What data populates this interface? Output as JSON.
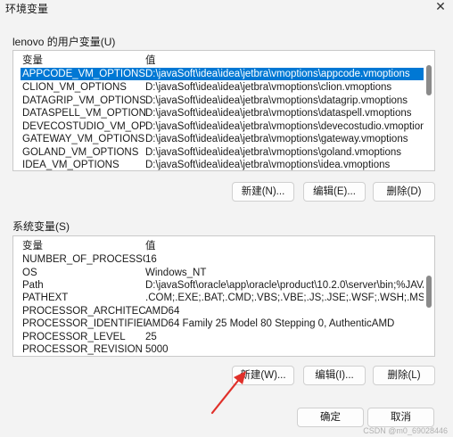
{
  "window": {
    "title": "环境变量",
    "close_glyph": "✕"
  },
  "user_vars": {
    "label": "lenovo 的用户变量(U)",
    "columns": [
      "变量",
      "值"
    ],
    "rows": [
      {
        "name": "APPCODE_VM_OPTIONS",
        "value": "D:\\javaSoft\\idea\\idea\\jetbra\\vmoptions\\appcode.vmoptions"
      },
      {
        "name": "CLION_VM_OPTIONS",
        "value": "D:\\javaSoft\\idea\\idea\\jetbra\\vmoptions\\clion.vmoptions"
      },
      {
        "name": "DATAGRIP_VM_OPTIONS",
        "value": "D:\\javaSoft\\idea\\idea\\jetbra\\vmoptions\\datagrip.vmoptions"
      },
      {
        "name": "DATASPELL_VM_OPTIONS",
        "value": "D:\\javaSoft\\idea\\idea\\jetbra\\vmoptions\\dataspell.vmoptions"
      },
      {
        "name": "DEVECOSTUDIO_VM_OPTI...",
        "value": "D:\\javaSoft\\idea\\idea\\jetbra\\vmoptions\\devecostudio.vmoptions"
      },
      {
        "name": "GATEWAY_VM_OPTIONS",
        "value": "D:\\javaSoft\\idea\\idea\\jetbra\\vmoptions\\gateway.vmoptions"
      },
      {
        "name": "GOLAND_VM_OPTIONS",
        "value": "D:\\javaSoft\\idea\\idea\\jetbra\\vmoptions\\goland.vmoptions"
      },
      {
        "name": "IDEA_VM_OPTIONS",
        "value": "D:\\javaSoft\\idea\\idea\\jetbra\\vmoptions\\idea.vmoptions"
      }
    ],
    "buttons": {
      "new": "新建(N)...",
      "edit": "编辑(E)...",
      "delete": "删除(D)"
    }
  },
  "system_vars": {
    "label": "系统变量(S)",
    "columns": [
      "变量",
      "值"
    ],
    "rows": [
      {
        "name": "NUMBER_OF_PROCESSORS",
        "value": "16"
      },
      {
        "name": "OS",
        "value": "Windows_NT"
      },
      {
        "name": "Path",
        "value": "D:\\javaSoft\\oracle\\app\\oracle\\product\\10.2.0\\server\\bin;%JAVA..."
      },
      {
        "name": "PATHEXT",
        "value": ".COM;.EXE;.BAT;.CMD;.VBS;.VBE;.JS;.JSE;.WSF;.WSH;.MSC"
      },
      {
        "name": "PROCESSOR_ARCHITECTU...",
        "value": "AMD64"
      },
      {
        "name": "PROCESSOR_IDENTIFIER",
        "value": "AMD64 Family 25 Model 80 Stepping 0, AuthenticAMD"
      },
      {
        "name": "PROCESSOR_LEVEL",
        "value": "25"
      },
      {
        "name": "PROCESSOR_REVISION",
        "value": "5000"
      }
    ],
    "buttons": {
      "new": "新建(W)...",
      "edit": "编辑(I)...",
      "delete": "删除(L)"
    }
  },
  "footer": {
    "ok": "确定",
    "cancel": "取消"
  },
  "watermark": "CSDN @m0_69028446",
  "colors": {
    "selection": "#0078d4",
    "arrow": "#e0302a"
  }
}
